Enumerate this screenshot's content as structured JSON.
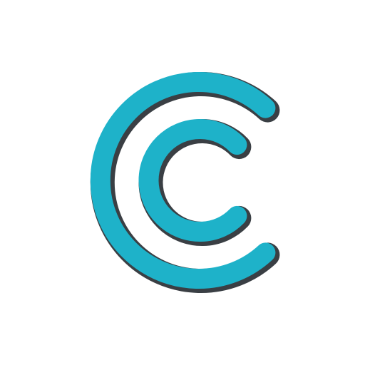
{
  "logo": {
    "icon": "double-c-logo-icon",
    "colors": {
      "fill": "#1eb2c9",
      "outline": "#3a3f44",
      "background": "#ffffff"
    }
  }
}
